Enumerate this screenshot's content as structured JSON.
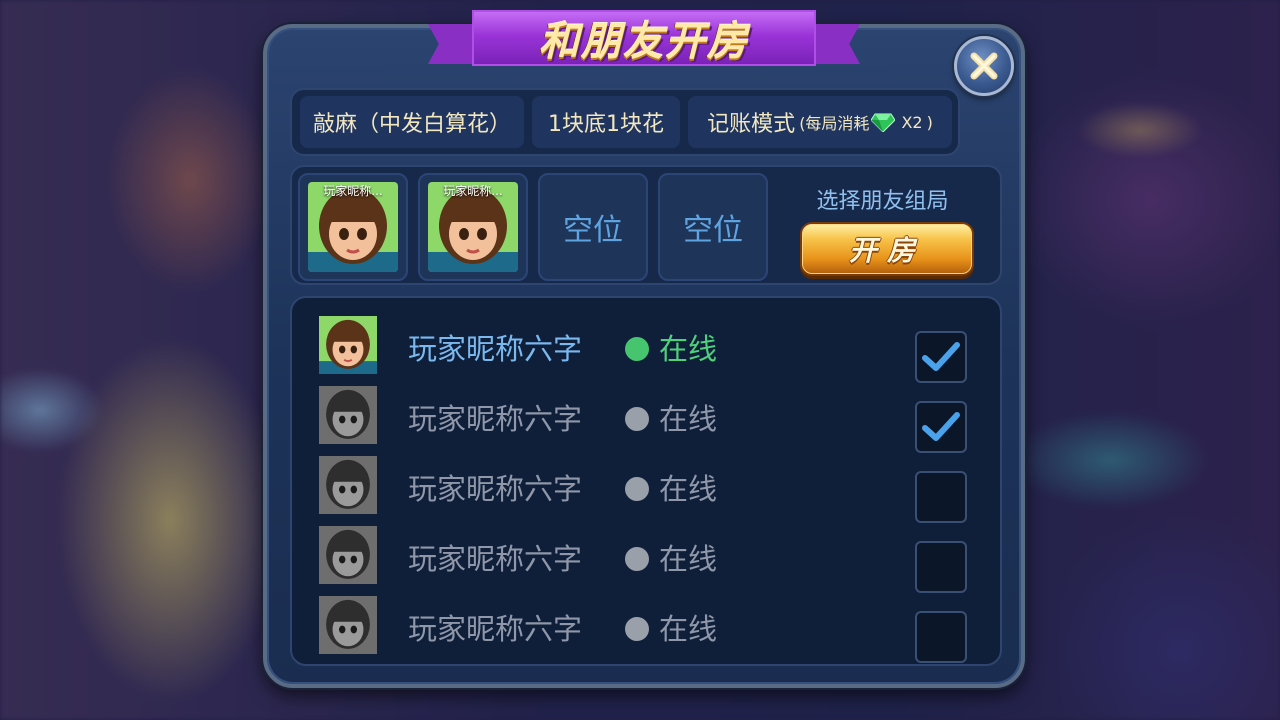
{
  "dialog": {
    "title": "和朋友开房"
  },
  "rules": {
    "game_mode": "敲麻（中发白算花）",
    "stakes": "1块底1块花",
    "billing_mode": "记账模式",
    "billing_note_open": "(每局消耗",
    "billing_multiplier": "X2",
    "billing_note_close": ")"
  },
  "seats": [
    {
      "occupied": true,
      "name": "玩家昵称..."
    },
    {
      "occupied": true,
      "name": "玩家昵称..."
    },
    {
      "occupied": false,
      "label": "空位"
    },
    {
      "occupied": false,
      "label": "空位"
    }
  ],
  "invite": {
    "pick_label": "选择朋友组局",
    "open_button_label": "开房"
  },
  "friends": [
    {
      "name": "玩家昵称六字",
      "status": "在线",
      "online": true,
      "checked": true
    },
    {
      "name": "玩家昵称六字",
      "status": "在线",
      "online": false,
      "checked": true
    },
    {
      "name": "玩家昵称六字",
      "status": "在线",
      "online": false,
      "checked": false
    },
    {
      "name": "玩家昵称六字",
      "status": "在线",
      "online": false,
      "checked": false
    },
    {
      "name": "玩家昵称六字",
      "status": "在线",
      "online": false,
      "checked": false
    }
  ],
  "colors": {
    "panel": "#1d3359",
    "ribbon": "#9a34d8",
    "button_gold": "#f7c34a",
    "online_green": "#46c46e",
    "offline_gray": "#9aa0aa",
    "check_blue": "#4aa3ea"
  },
  "icons": {
    "close": "close-icon",
    "gem": "gem-icon",
    "check": "check-icon",
    "avatar": "player-avatar"
  }
}
